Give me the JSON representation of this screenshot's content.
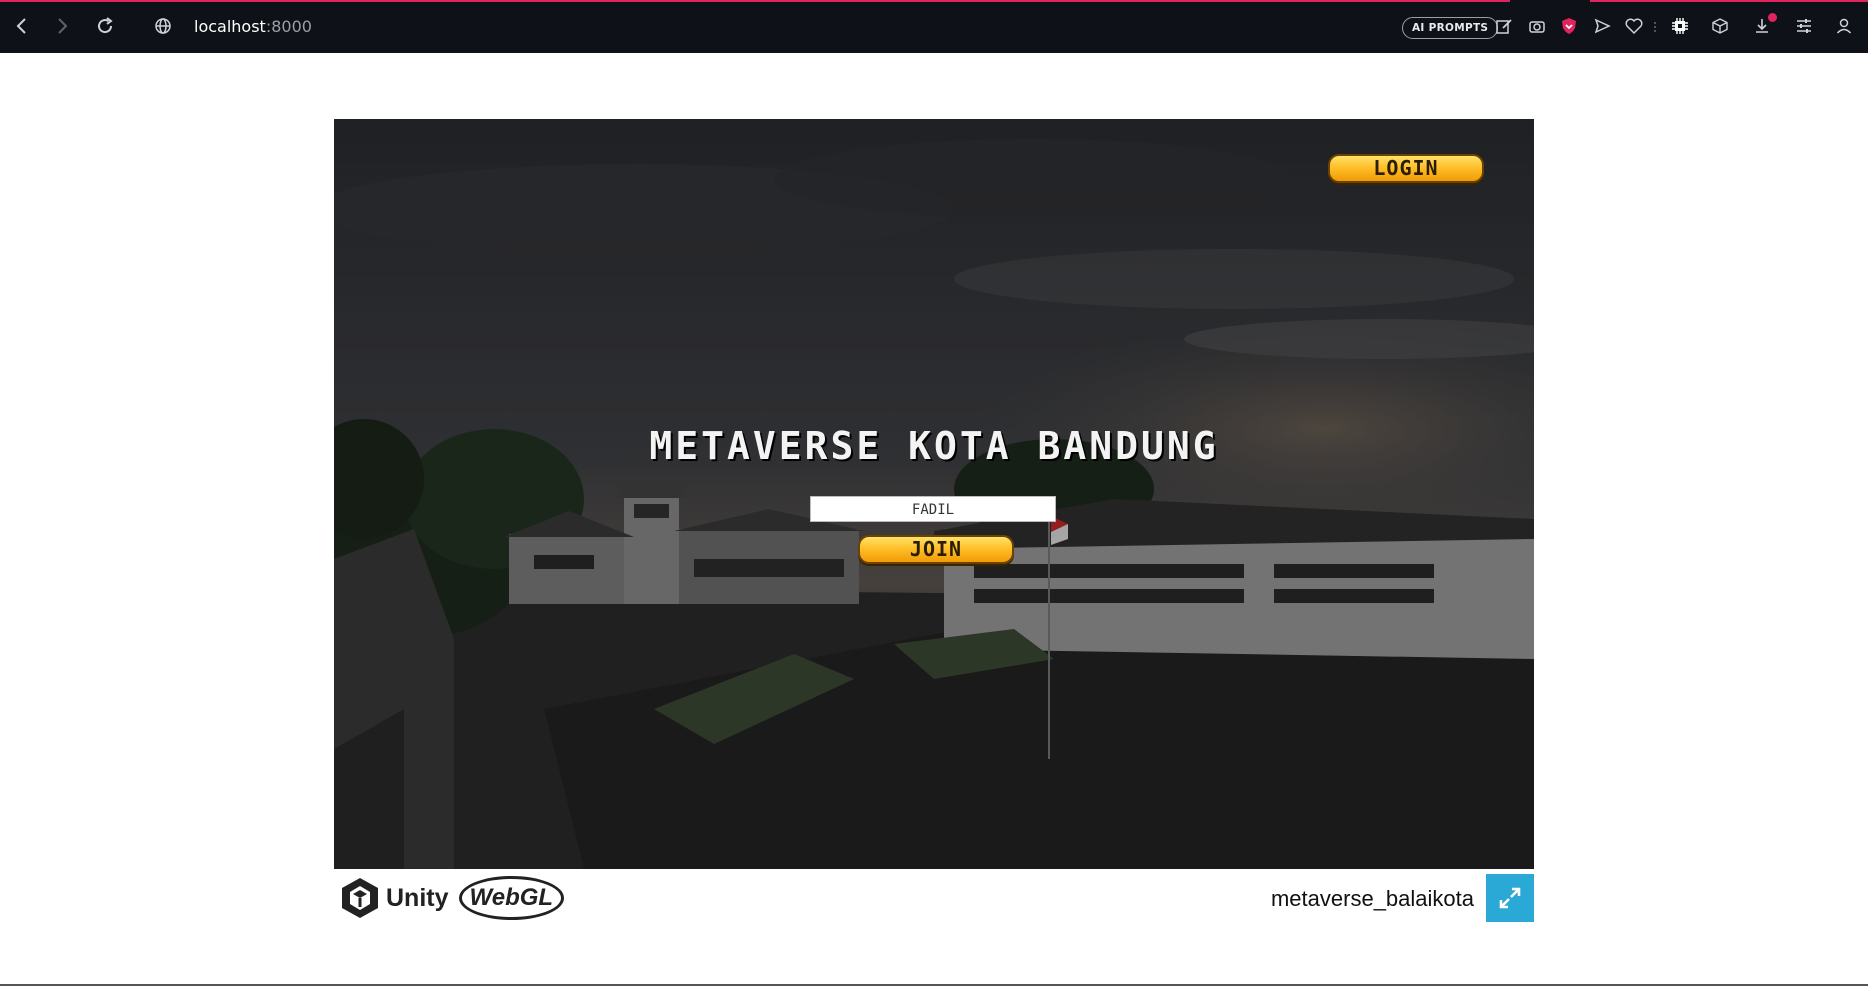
{
  "browser": {
    "url_host": "localhost",
    "url_port": ":8000",
    "ai_prompts_label": "AI PROMPTS"
  },
  "game": {
    "title": "METAVERSE KOTA BANDUNG",
    "name_input_value": "FADIL",
    "join_label": "JOIN",
    "login_label": "LOGIN"
  },
  "footer": {
    "unity_label": "Unity",
    "webgl_label": "WebGL",
    "build_title": "metaverse_balaikota"
  },
  "colors": {
    "accent_pill_top": "#ffe16a",
    "accent_pill_bottom": "#f29a06",
    "fullscreen_button": "#2aa8d6",
    "chrome_background": "#0e1117"
  }
}
